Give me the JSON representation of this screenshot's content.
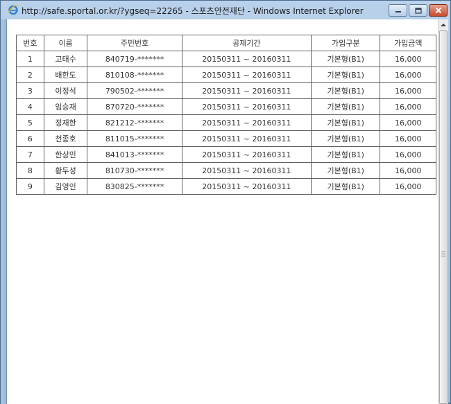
{
  "window": {
    "title": "http://safe.sportal.or.kr/?ygseq=22265 - 스포츠안전재단 - Windows Internet Explorer"
  },
  "icons": {
    "browser": "ie-logo-icon",
    "minimize": "minimize-icon",
    "maximize": "maximize-icon",
    "close": "close-icon",
    "scroll_up": "scroll-up-arrow-icon"
  },
  "colors": {
    "close_button": "#c94a2c",
    "title_bar": "#b9d1ea",
    "table_border": "#5f5f5f"
  },
  "table": {
    "headers": [
      "번호",
      "이름",
      "주민번호",
      "공제기간",
      "가입구분",
      "가입금액"
    ],
    "rows": [
      [
        "1",
        "고태수",
        "840719-*******",
        "20150311 ~ 20160311",
        "기본형(B1)",
        "16,000"
      ],
      [
        "2",
        "배한도",
        "810108-*******",
        "20150311 ~ 20160311",
        "기본형(B1)",
        "16,000"
      ],
      [
        "3",
        "이정석",
        "790502-*******",
        "20150311 ~ 20160311",
        "기본형(B1)",
        "16,000"
      ],
      [
        "4",
        "임승재",
        "870720-*******",
        "20150311 ~ 20160311",
        "기본형(B1)",
        "16,000"
      ],
      [
        "5",
        "정재한",
        "821212-*******",
        "20150311 ~ 20160311",
        "기본형(B1)",
        "16,000"
      ],
      [
        "6",
        "천종호",
        "811015-*******",
        "20150311 ~ 20160311",
        "기본형(B1)",
        "16,000"
      ],
      [
        "7",
        "한상민",
        "841013-*******",
        "20150311 ~ 20160311",
        "기본형(B1)",
        "16,000"
      ],
      [
        "8",
        "황두성",
        "810730-*******",
        "20150311 ~ 20160311",
        "기본형(B1)",
        "16,000"
      ],
      [
        "9",
        "김영인",
        "830825-*******",
        "20150311 ~ 20160311",
        "기본형(B1)",
        "16,000"
      ]
    ]
  }
}
